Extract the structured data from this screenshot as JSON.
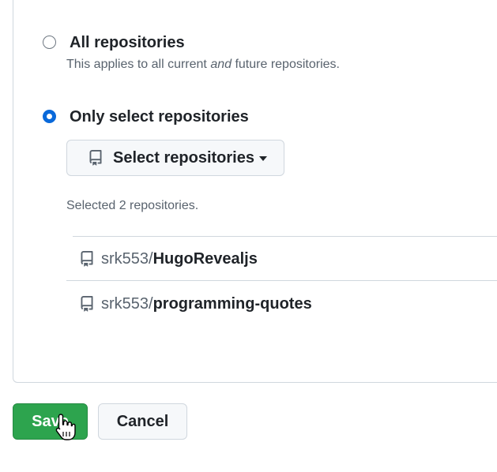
{
  "access": {
    "all_option": {
      "label": "All repositories",
      "desc_before": "This applies to all current ",
      "desc_emph": "and",
      "desc_after": " future repositories.",
      "selected": false
    },
    "select_option": {
      "label": "Only select repositories",
      "selected": true
    },
    "select_button": {
      "label": "Select repositories",
      "icon": "repo-icon"
    },
    "selected_count_text": "Selected 2 repositories.",
    "repos": [
      {
        "owner": "srk553/",
        "name": "HugoRevealjs",
        "icon": "repo-icon"
      },
      {
        "owner": "srk553/",
        "name": "programming-quotes",
        "icon": "repo-icon"
      }
    ]
  },
  "actions": {
    "save_label": "Save",
    "cancel_label": "Cancel"
  },
  "colors": {
    "primary_green": "#2da44e",
    "radio_blue": "#0969da",
    "border": "#d0d7de",
    "muted_text": "#59636e"
  }
}
